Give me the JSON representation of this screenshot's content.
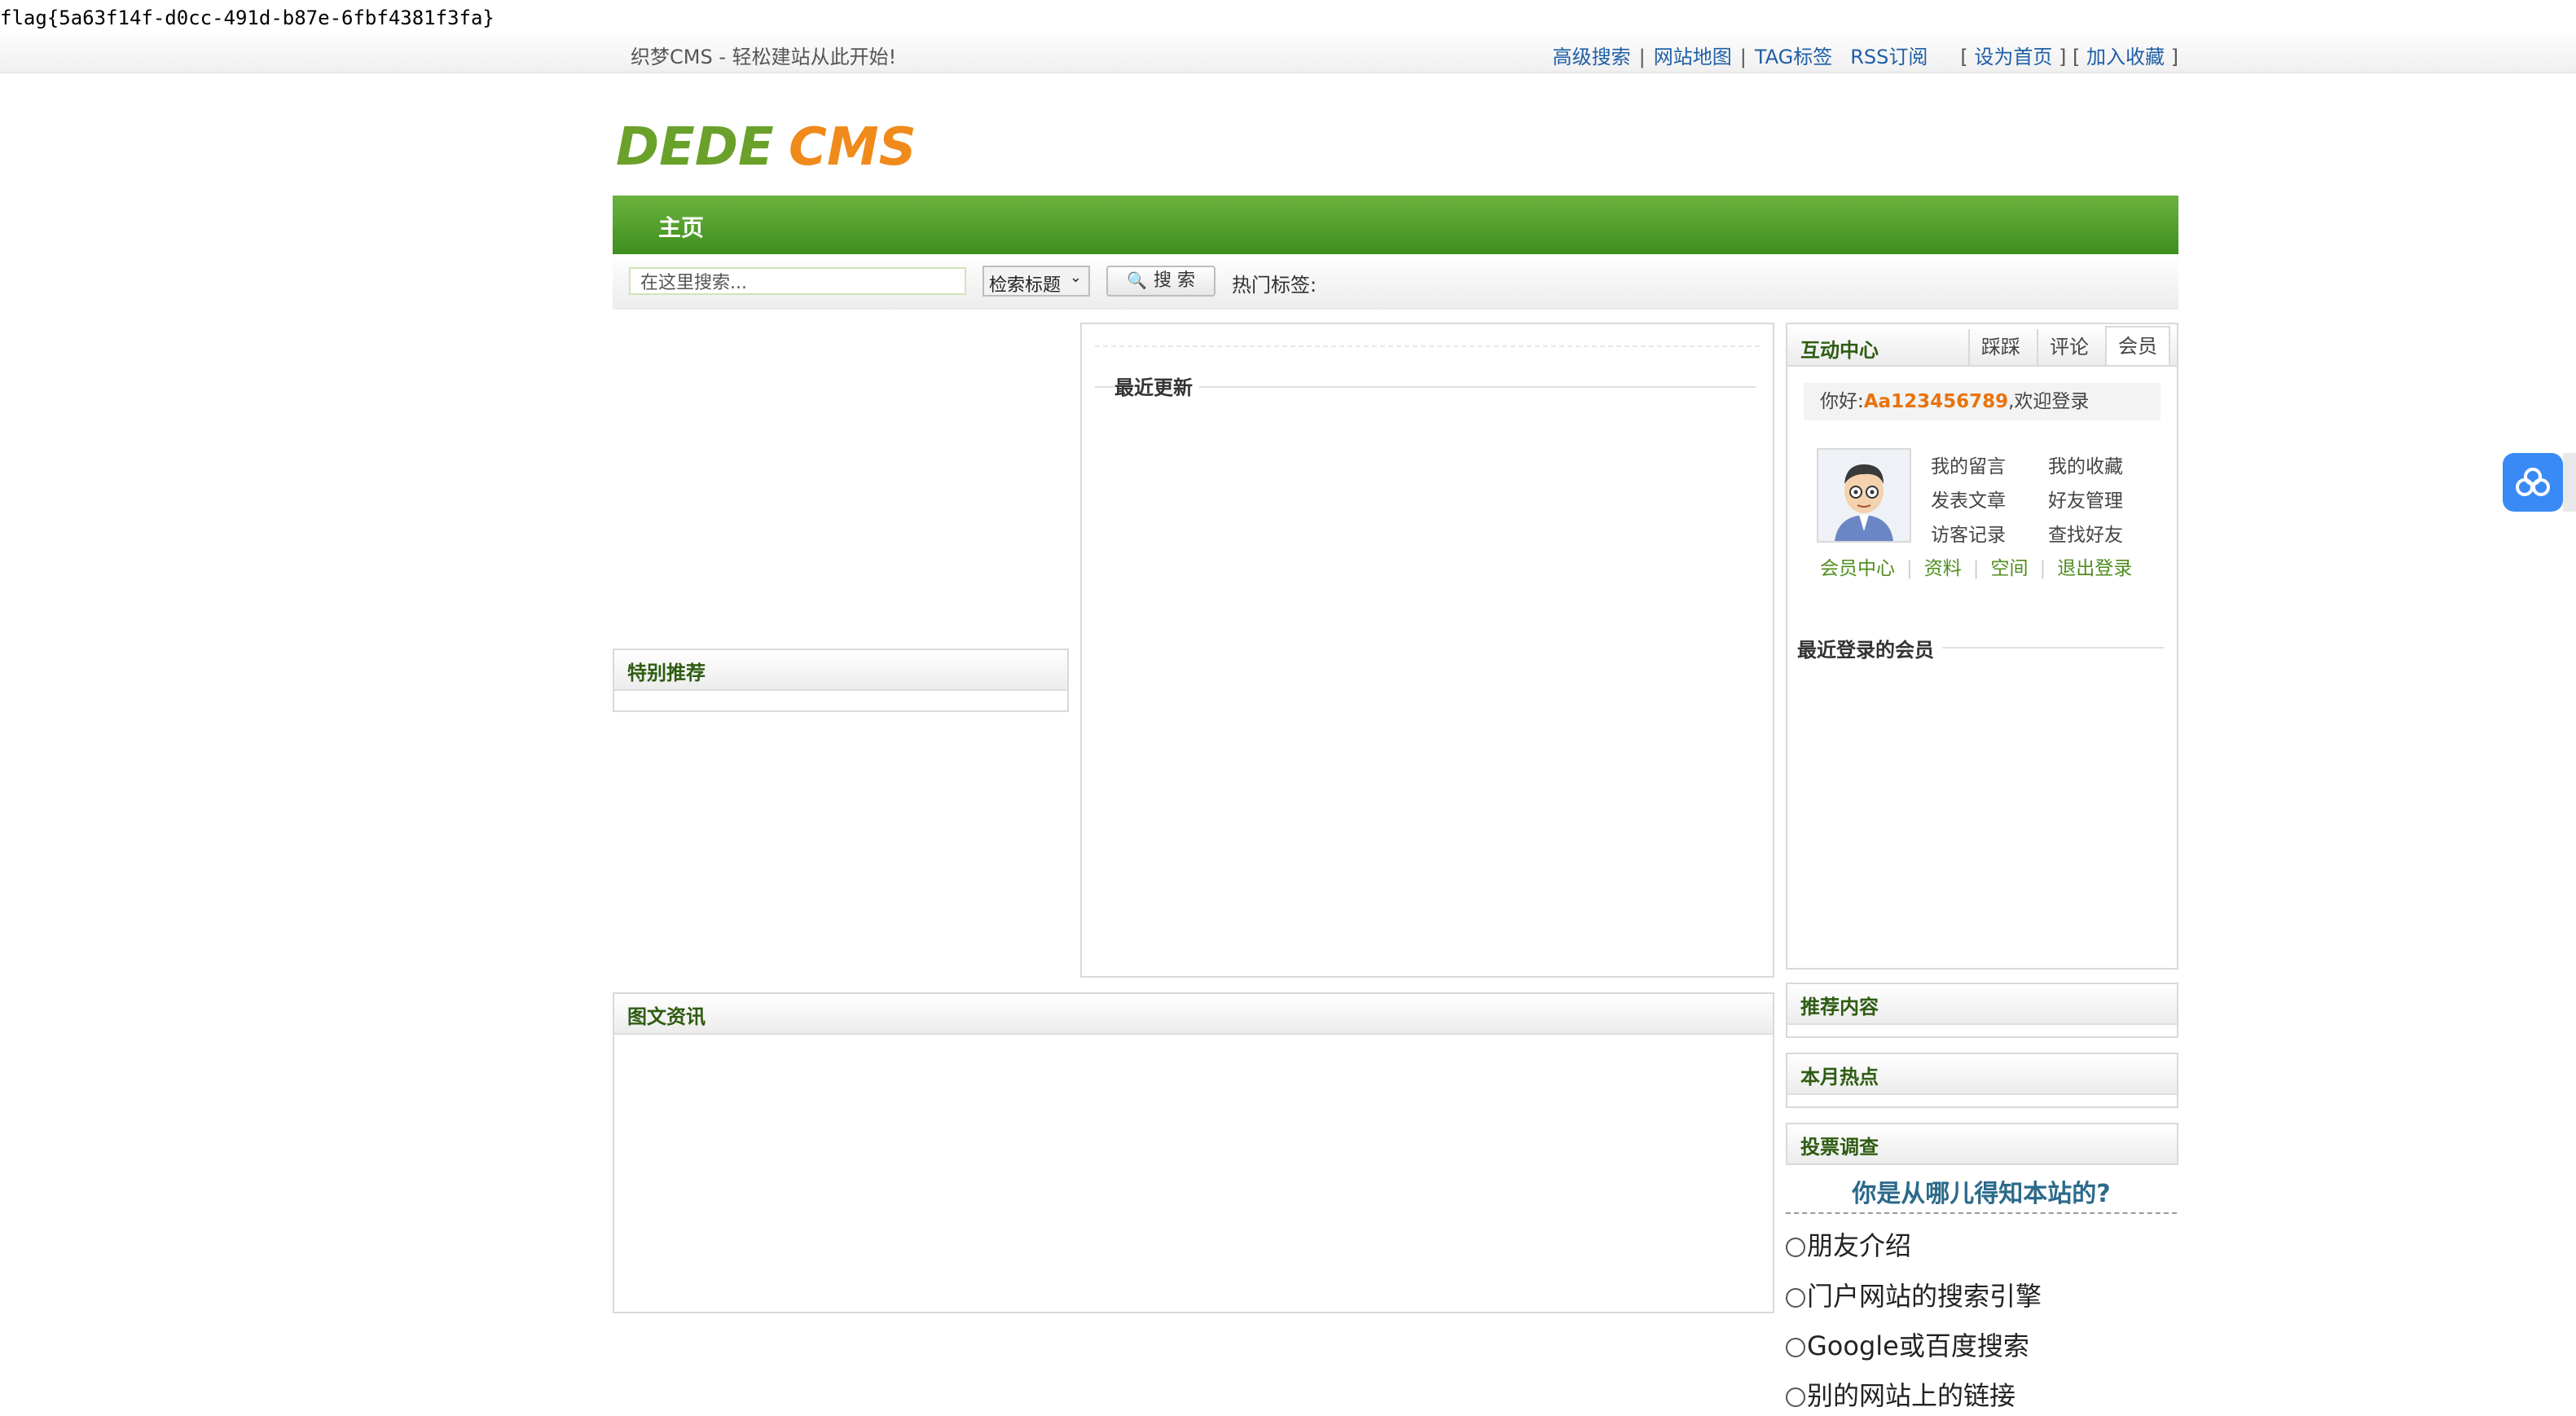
{
  "flag_text": "flag{5a63f14f-d0cc-491d-b87e-6fbf4381f3fa}",
  "topbar": {
    "slogan": "织梦CMS - 轻松建站从此开始!",
    "links": {
      "advanced_search": "高级搜索",
      "sitemap": "网站地图",
      "tags": "TAG标签",
      "rss": "RSS订阅",
      "set_home": "设为首页",
      "add_favorite": "加入收藏"
    }
  },
  "logo": {
    "text_left": "DEDE",
    "text_right": "CMS"
  },
  "nav": {
    "home": "主页"
  },
  "search": {
    "placeholder": "在这里搜索...",
    "type_selected": "检索标题",
    "button": "搜 索",
    "hot_tags_label": "热门标签:"
  },
  "left": {
    "featured_title": "特别推荐"
  },
  "center": {
    "latest_title": "最近更新"
  },
  "interaction": {
    "title": "互动中心",
    "tabs": [
      "踩踩",
      "评论",
      "会员"
    ],
    "hello_prefix": "你好:",
    "username": "Aa123456789",
    "hello_suffix": ",欢迎登录",
    "member_links": [
      "我的留言",
      "我的收藏",
      "发表文章",
      "好友管理",
      "访客记录",
      "查找好友"
    ],
    "bottom_links": [
      "会员中心",
      "资料",
      "空间",
      "退出登录"
    ],
    "recent_members_title": "最近登录的会员"
  },
  "picnews": {
    "title": "图文资讯"
  },
  "recommend": {
    "title": "推荐内容"
  },
  "hot_month": {
    "title": "本月热点"
  },
  "vote": {
    "title": "投票调查",
    "question": "你是从哪儿得知本站的?",
    "options": [
      "朋友介绍",
      "门户网站的搜索引擎",
      "Google或百度搜索",
      "别的网站上的链接"
    ]
  },
  "colors": {
    "nav_green": "#4a9a28",
    "link_blue": "#1f5fa6",
    "username_orange": "#e8730e"
  }
}
